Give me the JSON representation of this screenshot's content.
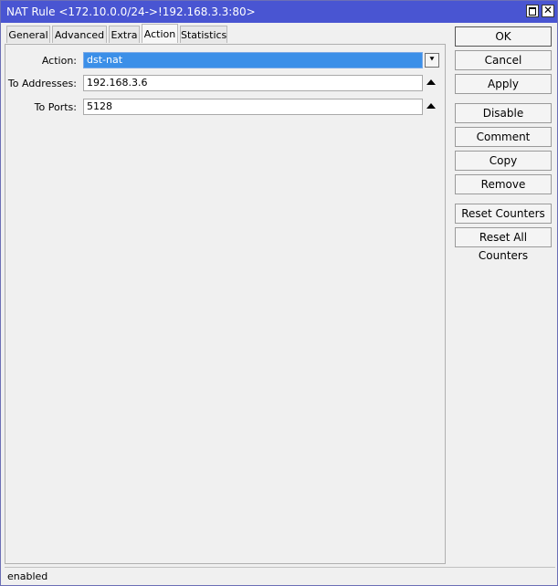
{
  "window": {
    "title": "NAT Rule <172.10.0.0/24->!192.168.3.3:80>",
    "maximize_icon": "maximize-icon",
    "close_icon": "close-icon",
    "close_glyph": "✕"
  },
  "tabs": [
    {
      "label": "General"
    },
    {
      "label": "Advanced"
    },
    {
      "label": "Extra"
    },
    {
      "label": "Action"
    },
    {
      "label": "Statistics"
    }
  ],
  "form": {
    "action": {
      "label": "Action:",
      "value": "dst-nat",
      "icon": "dropdown-arrow-icon",
      "glyph": "⯆"
    },
    "to_addresses": {
      "label": "To Addresses:",
      "value": "192.168.3.6",
      "icon": "collapse-up-icon"
    },
    "to_ports": {
      "label": "To Ports:",
      "value": "5128",
      "icon": "collapse-up-icon"
    }
  },
  "buttons": {
    "ok": "OK",
    "cancel": "Cancel",
    "apply": "Apply",
    "disable": "Disable",
    "comment": "Comment",
    "copy": "Copy",
    "remove": "Remove",
    "reset_counters": "Reset Counters",
    "reset_all_counters": "Reset All Counters"
  },
  "status": {
    "text": "enabled"
  },
  "colors": {
    "titlebar": "#4955d2",
    "selection": "#3b8fe8"
  }
}
